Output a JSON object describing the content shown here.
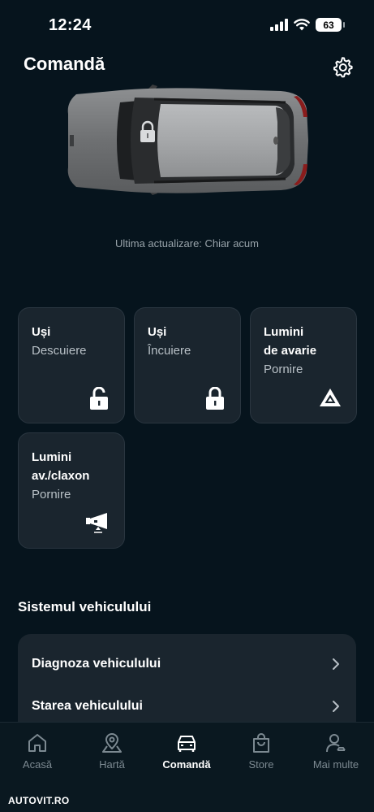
{
  "status_bar": {
    "time": "12:24",
    "battery": "63"
  },
  "header": {
    "title": "Comandă"
  },
  "vehicle": {
    "last_update": "Ultima actualizare: Chiar acum"
  },
  "controls": [
    {
      "title": "Uși",
      "subtitle": "Descuiere",
      "icon": "unlock-icon"
    },
    {
      "title": "Uși",
      "subtitle": "Încuiere",
      "icon": "lock-icon"
    },
    {
      "title_line1": "Lumini",
      "title_line2": "de avarie",
      "subtitle": "Pornire",
      "icon": "hazard-icon"
    },
    {
      "title_line1": "Lumini",
      "title_line2": "av./claxon",
      "subtitle": "Pornire",
      "icon": "horn-icon"
    }
  ],
  "system": {
    "title": "Sistemul vehiculului",
    "items": [
      {
        "label": "Diagnoza vehiculului"
      },
      {
        "label": "Starea vehiculului"
      }
    ]
  },
  "nav": {
    "items": [
      {
        "label": "Acasă",
        "icon": "home-icon"
      },
      {
        "label": "Hartă",
        "icon": "map-pin-icon"
      },
      {
        "label": "Comandă",
        "icon": "car-icon",
        "active": true
      },
      {
        "label": "Store",
        "icon": "shopping-bag-icon"
      },
      {
        "label": "Mai multe",
        "icon": "person-icon"
      }
    ]
  },
  "watermark": "AUTOVIT.RO",
  "colors": {
    "background": "#06141d",
    "card": "#1a252e",
    "muted_text": "#98a3aa"
  }
}
